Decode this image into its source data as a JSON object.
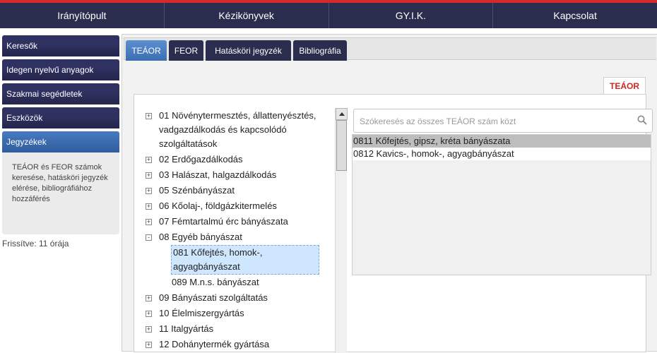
{
  "topnav": [
    "Irányítópult",
    "Kézikönyvek",
    "GY.I.K.",
    "Kapcsolat"
  ],
  "sidebar": {
    "items": [
      "Keresők",
      "Idegen nyelvű anyagok",
      "Szakmai segédletek",
      "Eszközök",
      "Jegyzékek"
    ],
    "active_index": 4,
    "panel_text": "TEÁOR és FEOR számok keresése, hatásköri jegyzék elérése, bibliográfiához hozzáférés",
    "updated": "Frissítve: 11 órája"
  },
  "tabs": [
    "TEÁOR",
    "FEOR",
    "Hatásköri jegyzék",
    "Bibliográfia"
  ],
  "content_tab": "TEÁOR",
  "tree": {
    "items": [
      {
        "label": "01 Növénytermesztés, állattenyésztés, vadgazdálkodás és kapcsolódó szolgáltatások",
        "expander": "+"
      },
      {
        "label": "02 Erdőgazdálkodás",
        "expander": "+"
      },
      {
        "label": "03 Halászat, halgazdálkodás",
        "expander": "+"
      },
      {
        "label": "05 Szénbányászat",
        "expander": "+"
      },
      {
        "label": "06 Kőolaj-, földgázkitermelés",
        "expander": "+"
      },
      {
        "label": "07 Fémtartalmú érc bányászata",
        "expander": "+"
      },
      {
        "label": "08 Egyéb bányászat",
        "expander": "-"
      },
      {
        "label": "09 Bányászati szolgáltatás",
        "expander": "+"
      },
      {
        "label": "10 Élelmiszergyártás",
        "expander": "+"
      },
      {
        "label": "11 Italgyártás",
        "expander": "+"
      },
      {
        "label": "12 Dohánytermék gyártása",
        "expander": "+"
      }
    ],
    "children": [
      "081 Kőfejtés, homok-, agyagbányászat",
      "089 M.n.s. bányászat"
    ]
  },
  "search": {
    "placeholder": "Szókeresés az összes TEÁOR szám közt"
  },
  "results": [
    "0811 Kőfejtés, gipsz, kréta bányászata",
    "0812 Kavics-, homok-, agyagbányászat"
  ]
}
